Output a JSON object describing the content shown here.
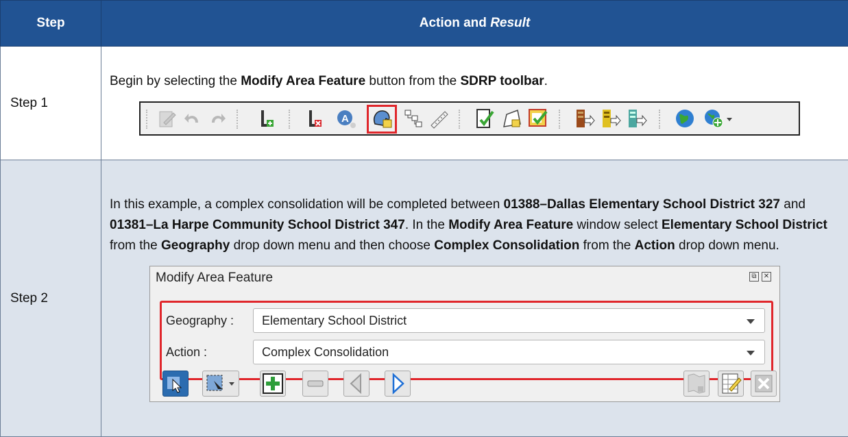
{
  "table": {
    "header_step": "Step",
    "header_action": "Action and ",
    "header_result": "Result"
  },
  "step1": {
    "label": "Step 1",
    "text": [
      {
        "t": "Begin by selecting the ",
        "b": false
      },
      {
        "t": "Modify Area Feature",
        "b": true
      },
      {
        "t": " button from the ",
        "b": false
      },
      {
        "t": "SDRP toolbar",
        "b": true
      },
      {
        "t": ".",
        "b": false
      }
    ],
    "toolbar_icons": [
      "edit-pencil-icon",
      "undo-icon",
      "redo-icon",
      "add-line-icon",
      "delete-line-icon",
      "address-icon",
      "modify-area-feature-icon",
      "tree-hierarchy-icon",
      "measure-ruler-icon",
      "review-check-icon",
      "polygon-edit-icon",
      "validate-icon",
      "export-icon",
      "import-icon",
      "copy-export-icon",
      "globe-icon",
      "add-globe-icon"
    ]
  },
  "step2": {
    "label": "Step 2",
    "text": [
      {
        "t": "In this example, a complex consolidation will be completed between ",
        "b": false
      },
      {
        "t": "01388–Dallas Elementary School District 327",
        "b": true
      },
      {
        "t": " and ",
        "b": false
      },
      {
        "t": "01381–La Harpe Community School District 347",
        "b": true
      },
      {
        "t": ". In the ",
        "b": false
      },
      {
        "t": "Modify Area Feature",
        "b": true
      },
      {
        "t": " window select ",
        "b": false
      },
      {
        "t": "Elementary School District",
        "b": true
      },
      {
        "t": " from the ",
        "b": false
      },
      {
        "t": "Geography",
        "b": true
      },
      {
        "t": " drop down menu and then choose ",
        "b": false
      },
      {
        "t": "Complex Consolidation",
        "b": true
      },
      {
        "t": " from the ",
        "b": false
      },
      {
        "t": "Action",
        "b": true
      },
      {
        "t": " drop down menu.",
        "b": false
      }
    ],
    "panel": {
      "title": "Modify Area Feature",
      "geography_label": "Geography :",
      "geography_value": "Elementary School District",
      "action_label": "Action :",
      "action_value": "Complex Consolidation"
    }
  },
  "colors": {
    "header_bg": "#215393",
    "row2_bg": "#dce3ec",
    "highlight": "#e0262b"
  }
}
